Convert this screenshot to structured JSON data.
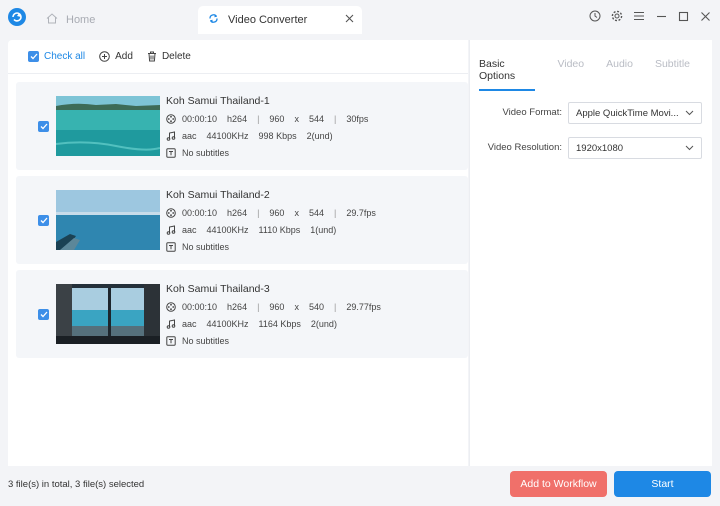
{
  "titlebar": {
    "tabs": [
      {
        "label": "Home",
        "icon": "home-icon"
      },
      {
        "label": "Video Converter",
        "icon": "convert-icon"
      }
    ],
    "controls": [
      "history-icon",
      "settings-icon",
      "menu-icon",
      "minimize-icon",
      "maximize-icon",
      "close-icon"
    ]
  },
  "toolbar": {
    "check_all": "Check all",
    "add": "Add",
    "delete": "Delete"
  },
  "files": [
    {
      "name": "Koh Samui Thailand-1",
      "duration": "00:00:10",
      "codec": "h264",
      "width": "960",
      "x": "x",
      "height": "544",
      "fps": "30fps",
      "audio": "aac",
      "rate": "44100KHz",
      "bitrate": "998 Kbps",
      "channels": "2(und)",
      "subtitles": "No subtitles",
      "checked": true
    },
    {
      "name": "Koh Samui Thailand-2",
      "duration": "00:00:10",
      "codec": "h264",
      "width": "960",
      "x": "x",
      "height": "544",
      "fps": "29.7fps",
      "audio": "aac",
      "rate": "44100KHz",
      "bitrate": "1110 Kbps",
      "channels": "1(und)",
      "subtitles": "No subtitles",
      "checked": true
    },
    {
      "name": "Koh Samui Thailand-3",
      "duration": "00:00:10",
      "codec": "h264",
      "width": "960",
      "x": "x",
      "height": "540",
      "fps": "29.77fps",
      "audio": "aac",
      "rate": "44100KHz",
      "bitrate": "1164 Kbps",
      "channels": "2(und)",
      "subtitles": "No subtitles",
      "checked": true
    }
  ],
  "options": {
    "tabs": [
      "Basic Options",
      "Video",
      "Audio",
      "Subtitle"
    ],
    "format_label": "Video Format:",
    "format_value": "Apple QuickTime Movi...",
    "resolution_label": "Video Resolution:",
    "resolution_value": "1920x1080"
  },
  "footer": {
    "status": "3 file(s) in total, 3 file(s) selected",
    "workflow_button": "Add to Workflow",
    "start_button": "Start"
  },
  "colors": {
    "accent": "#1e88e5",
    "workflow": "#f0706a"
  }
}
